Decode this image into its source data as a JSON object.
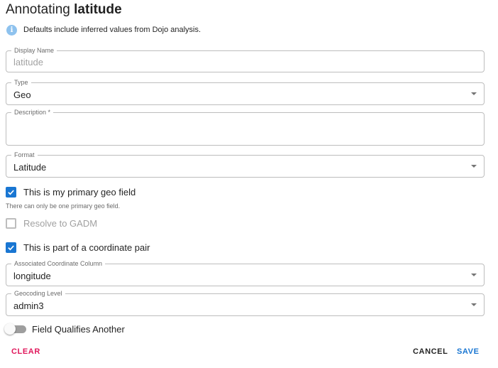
{
  "dialog": {
    "title_prefix": "Annotating ",
    "title_field": "latitude",
    "info_icon": "info-icon",
    "info_text": "Defaults include inferred values from Dojo analysis."
  },
  "form": {
    "display_name": {
      "label": "Display Name",
      "placeholder": "latitude",
      "value": ""
    },
    "type": {
      "label": "Type",
      "value": "Geo"
    },
    "description": {
      "label": "Description *",
      "value": ""
    },
    "format": {
      "label": "Format",
      "value": "Latitude"
    },
    "primary_geo": {
      "label": "This is my primary geo field",
      "checked": true,
      "helper": "There can only be one primary geo field."
    },
    "resolve_gadm": {
      "label": "Resolve to GADM",
      "checked": false,
      "disabled": true
    },
    "coordinate_pair": {
      "label": "This is part of a coordinate pair",
      "checked": true
    },
    "associated_column": {
      "label": "Associated Coordinate Column",
      "value": "longitude"
    },
    "geocoding_level": {
      "label": "Geocoding Level",
      "value": "admin3"
    },
    "qualifies_another": {
      "label": "Field Qualifies Another",
      "on": false
    }
  },
  "actions": {
    "clear": "CLEAR",
    "cancel": "CANCEL",
    "save": "SAVE"
  },
  "colors": {
    "primary": "#1976d2",
    "danger": "#e0175b",
    "info": "#8ec2ee"
  }
}
